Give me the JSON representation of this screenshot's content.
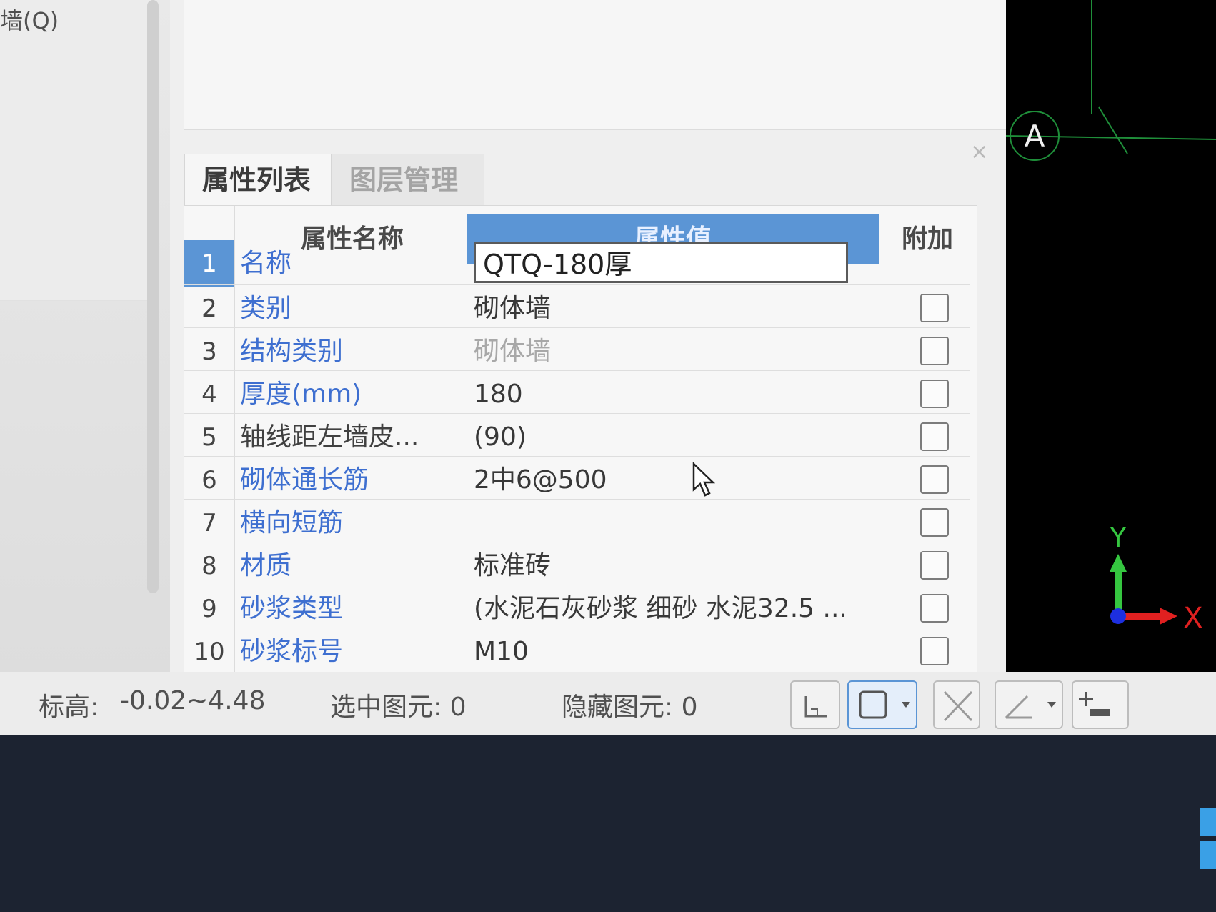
{
  "tree": {
    "label": "墙(Q)"
  },
  "tabs": [
    {
      "label": "属性列表"
    },
    {
      "label": "图层管理"
    }
  ],
  "grid": {
    "headers": {
      "name": "属性名称",
      "value": "属性值",
      "extra": "附加"
    },
    "rows": [
      {
        "num": "1",
        "name": "名称",
        "value": "QTQ-180厚"
      },
      {
        "num": "2",
        "name": "类别",
        "value": "砌体墙"
      },
      {
        "num": "3",
        "name": "结构类别",
        "value": "砌体墙"
      },
      {
        "num": "4",
        "name": "厚度(mm)",
        "value": "180"
      },
      {
        "num": "5",
        "name": "轴线距左墙皮...",
        "value": "(90)"
      },
      {
        "num": "6",
        "name": "砌体通长筋",
        "value": "2中6@500"
      },
      {
        "num": "7",
        "name": "横向短筋",
        "value": ""
      },
      {
        "num": "8",
        "name": "材质",
        "value": "标准砖"
      },
      {
        "num": "9",
        "name": "砂浆类型",
        "value": "(水泥石灰砂浆 细砂  水泥32.5 ..."
      },
      {
        "num": "10",
        "name": "砂浆标号",
        "value": "M10"
      }
    ]
  },
  "status": {
    "elevation_label": "标高:",
    "elevation_value": "-0.02~4.48",
    "selected": "选中图元: 0",
    "hidden": "隐藏图元: 0"
  },
  "viewport": {
    "axis_label": "A",
    "x_label": "X",
    "y_label": "Y"
  },
  "colors": {
    "accent": "#5b95d5",
    "link_text": "#3e6fd0",
    "grid_line": "#1f8f3a",
    "y_axis": "#35c640",
    "x_axis": "#e02020",
    "origin": "#1d2fe0"
  },
  "icons": [
    "close-icon",
    "corner-tool-icon",
    "rect-select-icon",
    "cross-icon",
    "angle-tool-icon",
    "plus-minus-icon",
    "cursor-icon",
    "windows-logo-icon"
  ]
}
